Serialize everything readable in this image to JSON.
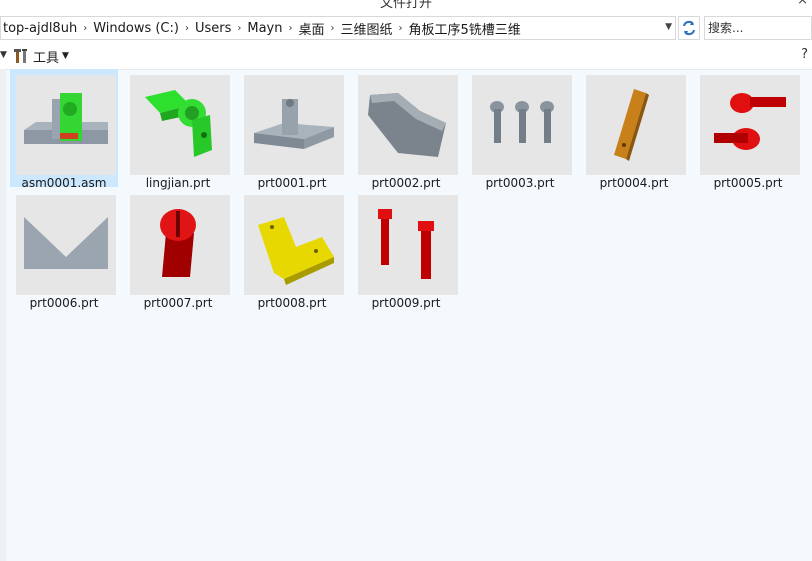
{
  "window": {
    "title": "文件打开",
    "close_glyph": "×"
  },
  "breadcrumb": {
    "items": [
      "top-ajdl8uh",
      "Windows (C:)",
      "Users",
      "Mayn",
      "桌面",
      "三维图纸",
      "角板工序5铣槽三维"
    ],
    "separator": "›"
  },
  "search": {
    "placeholder": "搜索..."
  },
  "toolbar": {
    "tools_label": "工具",
    "help_glyph": "?"
  },
  "files": [
    {
      "name": "asm0001.asm",
      "icon": "assembly-thumbnail",
      "selected": true
    },
    {
      "name": "lingjian.prt",
      "icon": "green-part-thumbnail"
    },
    {
      "name": "prt0001.prt",
      "icon": "gray-base-thumbnail"
    },
    {
      "name": "prt0002.prt",
      "icon": "gray-block-thumbnail"
    },
    {
      "name": "prt0003.prt",
      "icon": "screws-thumbnail"
    },
    {
      "name": "prt0004.prt",
      "icon": "orange-plate-thumbnail"
    },
    {
      "name": "prt0005.prt",
      "icon": "red-pins-thumbnail"
    },
    {
      "name": "prt0006.prt",
      "icon": "v-block-thumbnail"
    },
    {
      "name": "prt0007.prt",
      "icon": "red-knob-thumbnail"
    },
    {
      "name": "prt0008.prt",
      "icon": "yellow-bracket-thumbnail"
    },
    {
      "name": "prt0009.prt",
      "icon": "red-bolts-thumbnail"
    }
  ],
  "colors": {
    "selection": "#cce8ff",
    "thumb_bg": "#e6e6e6",
    "content_bg": "#f3f9fd"
  }
}
